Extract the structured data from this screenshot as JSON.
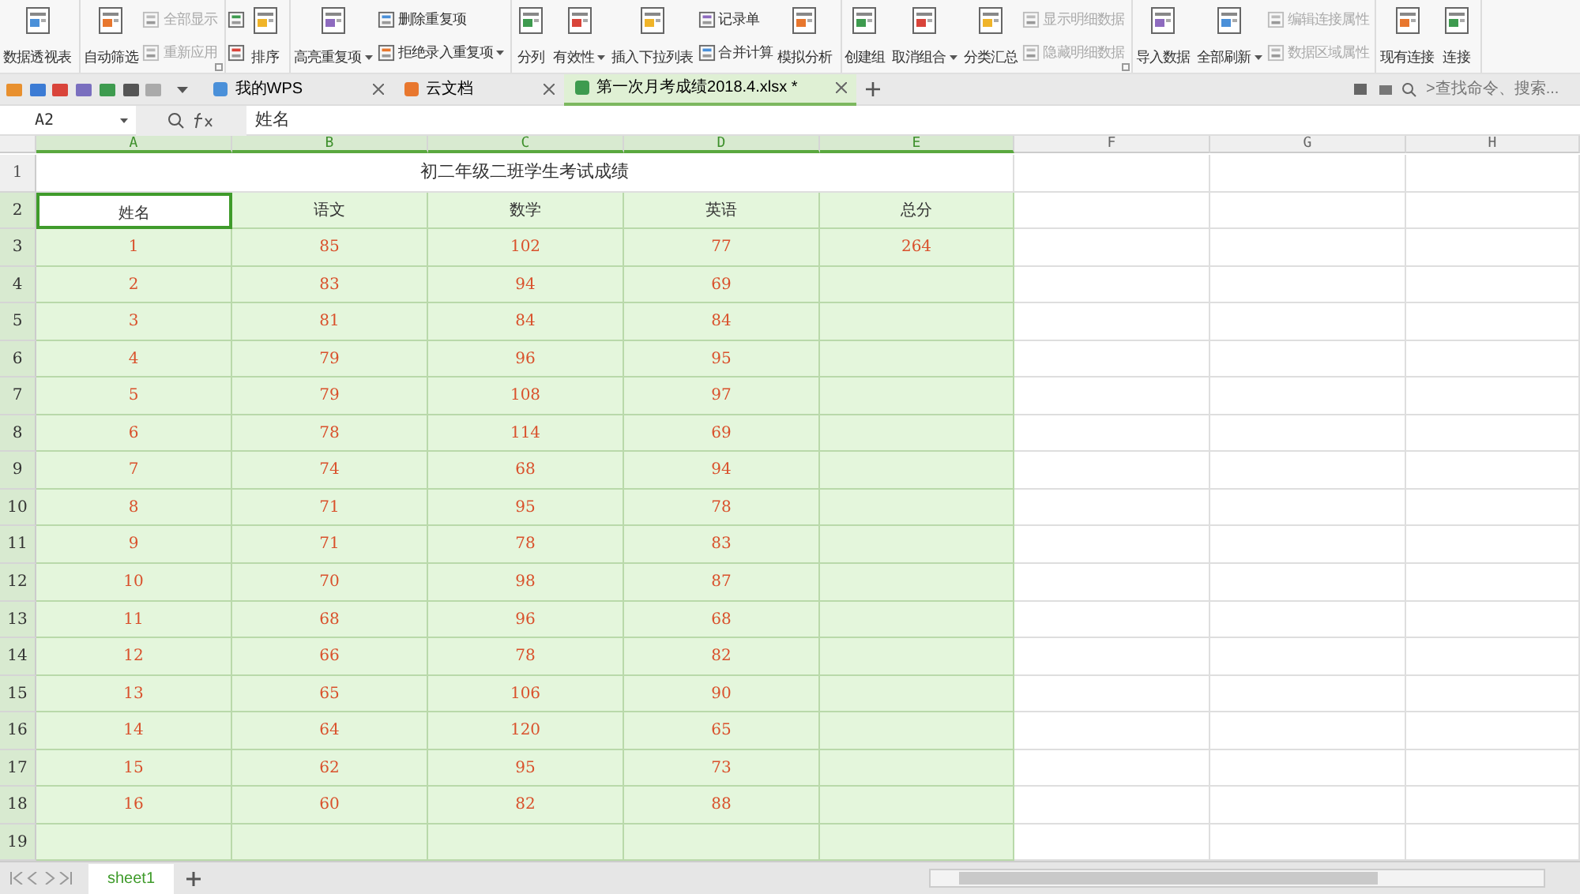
{
  "ribbon": [
    {
      "items": [
        {
          "kind": "big",
          "label": "数据透视表",
          "disabled": false,
          "dropdown": false
        }
      ]
    },
    {
      "launcher": true,
      "items": [
        {
          "kind": "big",
          "label": "自动筛选",
          "disabled": false,
          "dropdown": false
        },
        {
          "kind": "stack",
          "entries": [
            {
              "label": "全部显示",
              "disabled": true,
              "dropdown": false
            },
            {
              "label": "重新应用",
              "disabled": true,
              "dropdown": false
            }
          ]
        }
      ]
    },
    {
      "items": [
        {
          "kind": "stack",
          "entries": [
            {
              "disabled": false,
              "dropdown": false
            },
            {
              "disabled": false,
              "dropdown": false
            }
          ]
        },
        {
          "kind": "big",
          "label": "排序",
          "disabled": false,
          "dropdown": false
        }
      ]
    },
    {
      "items": [
        {
          "kind": "big",
          "label": "高亮重复项",
          "disabled": false,
          "dropdown": true
        },
        {
          "kind": "stack",
          "entries": [
            {
              "label": "删除重复项",
              "disabled": false,
              "dropdown": false
            },
            {
              "label": "拒绝录入重复项",
              "disabled": false,
              "dropdown": true
            }
          ]
        }
      ]
    },
    {
      "items": [
        {
          "kind": "big",
          "label": "分列",
          "disabled": false,
          "dropdown": false
        },
        {
          "kind": "big",
          "label": "有效性",
          "disabled": false,
          "dropdown": true
        },
        {
          "kind": "big",
          "label": "插入下拉列表",
          "disabled": false,
          "dropdown": false
        },
        {
          "kind": "stack",
          "entries": [
            {
              "label": "记录单",
              "disabled": false,
              "dropdown": false
            },
            {
              "label": "合并计算",
              "disabled": false,
              "dropdown": false
            }
          ]
        },
        {
          "kind": "big",
          "label": "模拟分析",
          "disabled": false,
          "dropdown": false
        }
      ]
    },
    {
      "launcher": true,
      "items": [
        {
          "kind": "big",
          "label": "创建组",
          "disabled": false,
          "dropdown": false
        },
        {
          "kind": "big",
          "label": "取消组合",
          "disabled": false,
          "dropdown": true
        },
        {
          "kind": "big",
          "label": "分类汇总",
          "disabled": false,
          "dropdown": false
        },
        {
          "kind": "stack",
          "entries": [
            {
              "label": "显示明细数据",
              "disabled": true,
              "dropdown": false
            },
            {
              "label": "隐藏明细数据",
              "disabled": true,
              "dropdown": false
            }
          ]
        }
      ]
    },
    {
      "items": [
        {
          "kind": "big",
          "label": "导入数据",
          "disabled": false,
          "dropdown": false
        },
        {
          "kind": "big",
          "label": "全部刷新",
          "disabled": false,
          "dropdown": true
        },
        {
          "kind": "stack",
          "entries": [
            {
              "label": "编辑连接属性",
              "disabled": true,
              "dropdown": false
            },
            {
              "label": "数据区域属性",
              "disabled": true,
              "dropdown": false
            }
          ]
        }
      ]
    },
    {
      "items": [
        {
          "kind": "big",
          "label": "现有连接",
          "disabled": false,
          "dropdown": false
        },
        {
          "kind": "big",
          "label": "连接",
          "disabled": false,
          "dropdown": false
        }
      ]
    }
  ],
  "tabs": [
    {
      "label": "我的WPS",
      "selected": false
    },
    {
      "label": "云文档",
      "selected": false
    },
    {
      "label": "第一次月考成绩2018.4.xlsx *",
      "selected": true
    }
  ],
  "search": {
    "placeholder": ">查找命令、搜索..."
  },
  "formula_bar": {
    "name_box": "A2",
    "value": "姓名"
  },
  "columns": [
    {
      "label": "A",
      "selected": true
    },
    {
      "label": "B",
      "selected": true
    },
    {
      "label": "C",
      "selected": true
    },
    {
      "label": "D",
      "selected": true
    },
    {
      "label": "E",
      "selected": true
    },
    {
      "label": "F",
      "selected": false
    },
    {
      "label": "G",
      "selected": false
    },
    {
      "label": "H",
      "selected": false
    }
  ],
  "rows": [
    {
      "number": "1",
      "selected": false,
      "kind": "title",
      "cells": [
        "初二年级二班学生考试成绩"
      ]
    },
    {
      "number": "2",
      "selected": true,
      "kind": "header",
      "cells": [
        {
          "text": "姓名",
          "active": true
        },
        {
          "text": "语文",
          "active": false
        },
        {
          "text": "数学",
          "active": false
        },
        {
          "text": "英语",
          "active": false
        },
        {
          "text": "总分",
          "active": false
        }
      ]
    },
    {
      "number": "3",
      "selected": true,
      "kind": "data",
      "cells": [
        "1",
        "85",
        "102",
        "77",
        "264"
      ]
    },
    {
      "number": "4",
      "selected": true,
      "kind": "data",
      "cells": [
        "2",
        "83",
        "94",
        "69"
      ]
    },
    {
      "number": "5",
      "selected": true,
      "kind": "data",
      "cells": [
        "3",
        "81",
        "84",
        "84"
      ]
    },
    {
      "number": "6",
      "selected": true,
      "kind": "data",
      "cells": [
        "4",
        "79",
        "96",
        "95"
      ]
    },
    {
      "number": "7",
      "selected": true,
      "kind": "data",
      "cells": [
        "5",
        "79",
        "108",
        "97"
      ]
    },
    {
      "number": "8",
      "selected": true,
      "kind": "data",
      "cells": [
        "6",
        "78",
        "114",
        "69"
      ]
    },
    {
      "number": "9",
      "selected": true,
      "kind": "data",
      "cells": [
        "7",
        "74",
        "68",
        "94"
      ]
    },
    {
      "number": "10",
      "selected": true,
      "kind": "data",
      "cells": [
        "8",
        "71",
        "95",
        "78"
      ]
    },
    {
      "number": "11",
      "selected": true,
      "kind": "data",
      "cells": [
        "9",
        "71",
        "78",
        "83"
      ]
    },
    {
      "number": "12",
      "selected": true,
      "kind": "data",
      "cells": [
        "10",
        "70",
        "98",
        "87"
      ]
    },
    {
      "number": "13",
      "selected": true,
      "kind": "data",
      "cells": [
        "11",
        "68",
        "96",
        "68"
      ]
    },
    {
      "number": "14",
      "selected": true,
      "kind": "data",
      "cells": [
        "12",
        "66",
        "78",
        "82"
      ]
    },
    {
      "number": "15",
      "selected": true,
      "kind": "data",
      "cells": [
        "13",
        "65",
        "106",
        "90"
      ]
    },
    {
      "number": "16",
      "selected": true,
      "kind": "data",
      "cells": [
        "14",
        "64",
        "120",
        "65"
      ]
    },
    {
      "number": "17",
      "selected": true,
      "kind": "data",
      "cells": [
        "15",
        "62",
        "95",
        "73"
      ]
    },
    {
      "number": "18",
      "selected": true,
      "kind": "data",
      "cells": [
        "16",
        "60",
        "82",
        "88"
      ]
    },
    {
      "number": "19",
      "selected": true,
      "kind": "data"
    }
  ],
  "sheets": [
    {
      "label": "sheet1",
      "selected": true
    }
  ]
}
